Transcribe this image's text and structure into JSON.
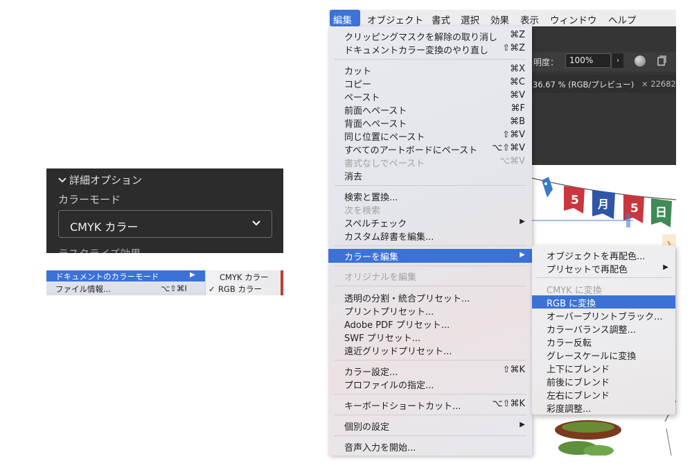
{
  "options_panel": {
    "header": "詳細オプション",
    "color_mode_label": "カラーモード",
    "color_mode_value": "CMYK カラー",
    "cut_off_text": "ラスタライズ効果"
  },
  "doc_menu": {
    "item1_label": "ドキュメントのカラーモード",
    "item1_arrow": "▶",
    "item2_label": "ファイル情報...",
    "item2_shortcut": "⌥⇧⌘I",
    "sub_cmyk": "CMYK カラー",
    "sub_rgb_check": "✓",
    "sub_rgb": "RGB カラー"
  },
  "menubar": {
    "items": [
      "編集",
      "オブジェクト",
      "書式",
      "選択",
      "効果",
      "表示",
      "ウィンドウ",
      "ヘルプ"
    ]
  },
  "control_bar": {
    "opacity_label": "明度：",
    "opacity_value": "100%",
    "opacity_btn": "›",
    "tab_label": "36.67 % (RGB/プレビュー)",
    "tab_close": "× 22682"
  },
  "artwork": {
    "banner_flags": [
      "5",
      "月",
      "5",
      "日"
    ]
  },
  "edit_menu": {
    "items": [
      {
        "label": "クリッピングマスクを解除の取り消し",
        "shortcut": "⌘Z"
      },
      {
        "label": "ドキュメントカラー変換のやり直し",
        "shortcut": "⇧⌘Z"
      },
      {
        "label": "カット",
        "shortcut": "⌘X"
      },
      {
        "label": "コピー",
        "shortcut": "⌘C"
      },
      {
        "label": "ペースト",
        "shortcut": "⌘V"
      },
      {
        "label": "前面へペースト",
        "shortcut": "⌘F"
      },
      {
        "label": "背面へペースト",
        "shortcut": "⌘B"
      },
      {
        "label": "同じ位置にペースト",
        "shortcut": "⇧⌘V"
      },
      {
        "label": "すべてのアートボードにペースト",
        "shortcut": "⌥⇧⌘V"
      },
      {
        "label": "書式なしでペースト",
        "shortcut": "⌥⌘V"
      },
      {
        "label": "消去",
        "shortcut": ""
      },
      {
        "label": "検索と置換...",
        "shortcut": ""
      },
      {
        "label": "次を検索",
        "shortcut": ""
      },
      {
        "label": "スペルチェック",
        "shortcut": "▶"
      },
      {
        "label": "カスタム辞書を編集...",
        "shortcut": ""
      },
      {
        "label": "カラーを編集",
        "shortcut": "▶"
      },
      {
        "label": "オリジナルを編集",
        "shortcut": ""
      },
      {
        "label": "透明の分割・統合プリセット...",
        "shortcut": ""
      },
      {
        "label": "プリントプリセット...",
        "shortcut": ""
      },
      {
        "label": "Adobe PDF プリセット...",
        "shortcut": ""
      },
      {
        "label": "SWF プリセット...",
        "shortcut": ""
      },
      {
        "label": "遠近グリッドプリセット...",
        "shortcut": ""
      },
      {
        "label": "カラー設定...",
        "shortcut": "⇧⌘K"
      },
      {
        "label": "プロファイルの指定...",
        "shortcut": ""
      },
      {
        "label": "キーボードショートカット...",
        "shortcut": "⌥⇧⌘K"
      },
      {
        "label": "個別の設定",
        "shortcut": "▶"
      },
      {
        "label": "音声入力を開始...",
        "shortcut": ""
      }
    ]
  },
  "color_menu": {
    "items": [
      {
        "label": "オブジェクトを再配色...",
        "shortcut": ""
      },
      {
        "label": "プリセットで再配色",
        "shortcut": "▶"
      },
      {
        "label": "CMYK に変換",
        "shortcut": ""
      },
      {
        "label": "RGB に変換",
        "shortcut": ""
      },
      {
        "label": "オーバープリントブラック...",
        "shortcut": ""
      },
      {
        "label": "カラーバランス調整...",
        "shortcut": ""
      },
      {
        "label": "カラー反転",
        "shortcut": ""
      },
      {
        "label": "グレースケールに変換",
        "shortcut": ""
      },
      {
        "label": "上下にブレンド",
        "shortcut": ""
      },
      {
        "label": "前後にブレンド",
        "shortcut": ""
      },
      {
        "label": "左右にブレンド",
        "shortcut": ""
      },
      {
        "label": "彩度調整...",
        "shortcut": ""
      }
    ]
  }
}
